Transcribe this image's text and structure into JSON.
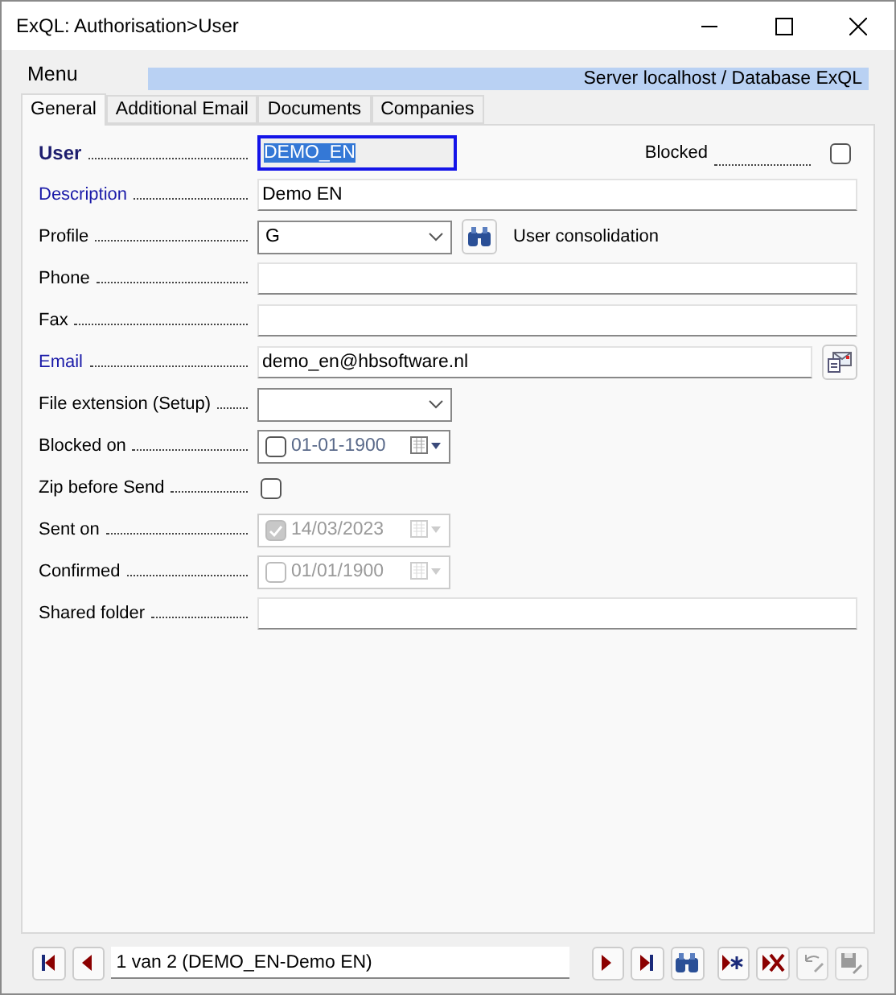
{
  "window": {
    "title": "ExQL: Authorisation>User"
  },
  "menu": "Menu",
  "status": "Server localhost / Database ExQL",
  "tabs": [
    {
      "label": "General",
      "selected": true
    },
    {
      "label": "Additional Email",
      "selected": false
    },
    {
      "label": "Documents",
      "selected": false
    },
    {
      "label": "Companies",
      "selected": false
    }
  ],
  "fields": [
    {
      "kind": "text",
      "label": "User",
      "bold": true,
      "required": true,
      "focused": true,
      "value": "DEMO_EN",
      "side": {
        "label": "Blocked",
        "checked": false
      }
    },
    {
      "kind": "text",
      "label": "Description",
      "bold": false,
      "required": true,
      "focused": false,
      "value": "Demo EN"
    },
    {
      "kind": "combo",
      "label": "Profile",
      "bold": false,
      "required": false,
      "focused": false,
      "value": "G",
      "lookup": true,
      "note": "User consolidation"
    },
    {
      "kind": "text",
      "label": "Phone",
      "bold": false,
      "required": false,
      "focused": false
    },
    {
      "kind": "text",
      "label": "Fax",
      "bold": false,
      "required": false,
      "focused": false
    },
    {
      "kind": "email",
      "label": "Email",
      "bold": false,
      "required": true,
      "focused": false,
      "value": "demo_en@hbsoftware.nl"
    },
    {
      "kind": "combo",
      "label": "File extension (Setup)",
      "bold": false,
      "required": false,
      "focused": false,
      "lookup": false
    },
    {
      "kind": "date",
      "label": "Blocked on",
      "bold": false,
      "required": false,
      "focused": false,
      "value": "01-01-1900",
      "checked": false,
      "disabled": false
    },
    {
      "kind": "check",
      "label": "Zip before Send",
      "bold": false,
      "required": false,
      "focused": false,
      "checked": false
    },
    {
      "kind": "date",
      "label": "Sent on",
      "bold": false,
      "required": false,
      "focused": false,
      "value": "14/03/2023",
      "checked": true,
      "disabled": true
    },
    {
      "kind": "date",
      "label": "Confirmed",
      "bold": false,
      "required": false,
      "focused": false,
      "value": "01/01/1900",
      "checked": false,
      "disabled": true
    },
    {
      "kind": "text",
      "label": "Shared folder",
      "bold": false,
      "required": false,
      "focused": false
    }
  ],
  "navigator": {
    "record": "1 van 2 (DEMO_EN-Demo EN)",
    "buttons": [
      {
        "kind": "first",
        "disabled": false
      },
      {
        "kind": "prev",
        "disabled": false
      },
      {
        "kind": "record"
      },
      {
        "kind": "next",
        "disabled": false
      },
      {
        "kind": "last",
        "disabled": false
      },
      {
        "kind": "find",
        "disabled": false
      },
      {
        "kind": "new",
        "disabled": false
      },
      {
        "kind": "delete",
        "disabled": false
      },
      {
        "kind": "undo",
        "disabled": true
      },
      {
        "kind": "save",
        "disabled": true
      }
    ]
  }
}
